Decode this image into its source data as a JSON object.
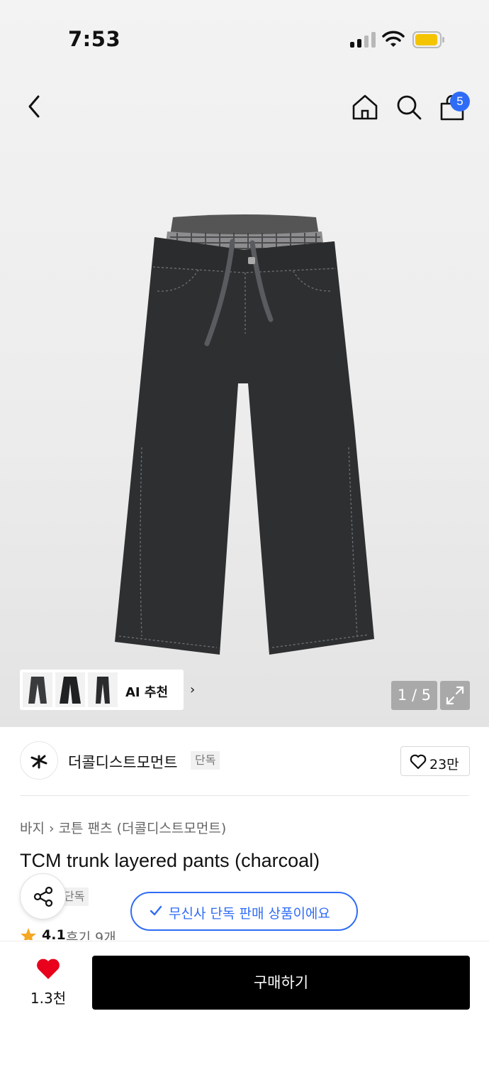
{
  "status": {
    "time": "7:53"
  },
  "header": {
    "cart_count": "5"
  },
  "gallery": {
    "ai_label": "AI 추천",
    "ai_chevron": "›",
    "page_indicator": "1 / 5"
  },
  "brand": {
    "name": "더콜디스트모먼트",
    "tag": "단독",
    "likes": "23만"
  },
  "breadcrumb": {
    "category": "바지",
    "separator": "›",
    "subcategory": "코튼 팬츠 (더콜디스트모먼트)"
  },
  "product": {
    "title": "TCM trunk layered pants (charcoal)",
    "tag": "단독"
  },
  "verify": {
    "label": "무신사 단독 판매 상품이에요"
  },
  "rating": {
    "value": "4.1",
    "reviews": "후기 9개"
  },
  "bottom": {
    "like_count": "1.3천",
    "buy_label": "구매하기"
  },
  "colors": {
    "accent": "#2f6cf6",
    "heart": "#e8001c",
    "star": "#f5a623",
    "buy": "#000000"
  },
  "icons": [
    "back-arrow-icon",
    "home-icon",
    "search-icon",
    "shopping-bag-icon",
    "expand-icon",
    "heart-outline-icon",
    "share-icon",
    "check-icon",
    "star-icon",
    "heart-filled-icon"
  ]
}
